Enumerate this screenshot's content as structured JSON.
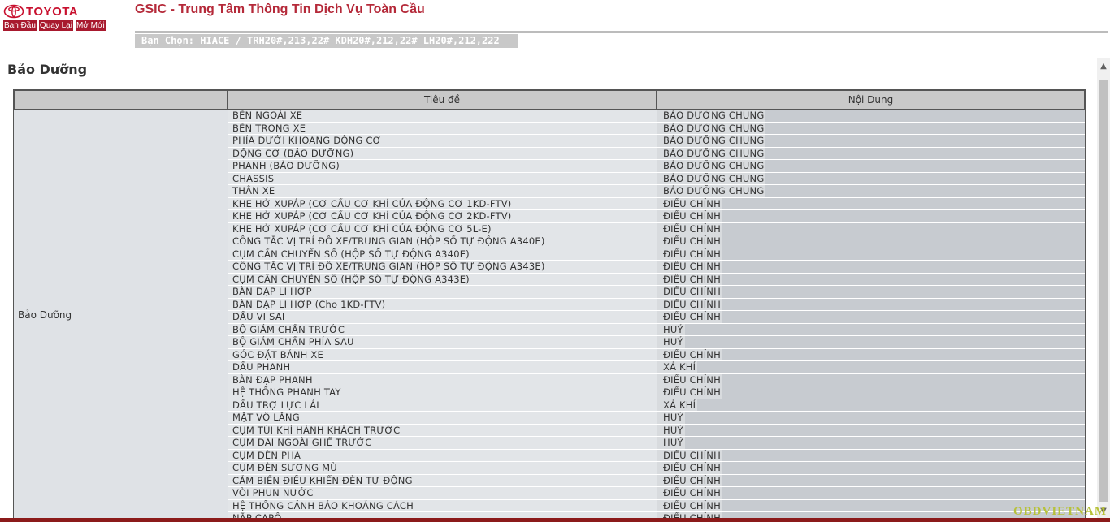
{
  "header": {
    "logo_text": "TOYOTA",
    "app_title": "GSIC - Trung Tâm Thông Tin Dịch Vụ Toàn Cầu",
    "nav": [
      "Ban Đầu",
      "Quay Lại",
      "Mở Mới"
    ],
    "selection": "Bạn Chọn: HIACE / TRH20#,213,22# KDH20#,212,22# LH20#,212,222"
  },
  "section_title": "Bảo Dưỡng",
  "table": {
    "headers": [
      "",
      "Tiêu đề",
      "Nội Dung"
    ],
    "group_label": "Bảo Dưỡng",
    "rows": [
      {
        "title": "BÊN NGOÀI XE",
        "content": "BẢO DƯỠNG CHUNG"
      },
      {
        "title": "BÊN TRONG XE",
        "content": "BẢO DƯỠNG CHUNG"
      },
      {
        "title": "PHÍA DƯỚI KHOANG ĐỘNG CƠ",
        "content": "BẢO DƯỠNG CHUNG"
      },
      {
        "title": "ĐỘNG CƠ (BẢO DƯỠNG)",
        "content": "BẢO DƯỠNG CHUNG"
      },
      {
        "title": "PHANH (BẢO DƯỠNG)",
        "content": "BẢO DƯỠNG CHUNG"
      },
      {
        "title": "CHASSIS",
        "content": "BẢO DƯỠNG CHUNG"
      },
      {
        "title": "THÂN XE",
        "content": "BẢO DƯỠNG CHUNG"
      },
      {
        "title": "KHE HỞ XUPÁP (CƠ CẤU CƠ KHÍ CỦA ĐỘNG CƠ 1KD-FTV)",
        "content": "ĐIỀU CHỈNH"
      },
      {
        "title": "KHE HỞ XUPÁP (CƠ CẤU CƠ KHÍ CỦA ĐỘNG CƠ 2KD-FTV)",
        "content": "ĐIỀU CHỈNH"
      },
      {
        "title": "KHE HỞ XUPÁP (CƠ CẤU CƠ KHÍ CỦA ĐỘNG CƠ 5L-E)",
        "content": "ĐIỀU CHỈNH"
      },
      {
        "title": "CÔNG TẮC VỊ TRÍ ĐỖ XE/TRUNG GIAN (HỘP SỐ TỰ ĐỘNG A340E)",
        "content": "ĐIỀU CHỈNH"
      },
      {
        "title": "CỤM CẦN CHUYỂN SỐ (HỘP SỐ TỰ ĐỘNG A340E)",
        "content": "ĐIỀU CHỈNH"
      },
      {
        "title": "CÔNG TẮC VỊ TRÍ ĐỖ XE/TRUNG GIAN (HỘP SỐ TỰ ĐỘNG A343E)",
        "content": "ĐIỀU CHỈNH"
      },
      {
        "title": "CỤM CẦN CHUYỂN SỐ (HỘP SỐ TỰ ĐỘNG A343E)",
        "content": "ĐIỀU CHỈNH"
      },
      {
        "title": "BÀN ĐẠP LI HỢP",
        "content": "ĐIỀU CHỈNH"
      },
      {
        "title": "BÀN ĐẠP LI HỢP (Cho 1KD-FTV)",
        "content": "ĐIỀU CHỈNH"
      },
      {
        "title": "DẦU VI SAI",
        "content": "ĐIỀU CHỈNH"
      },
      {
        "title": "BỘ GIẢM CHẤN TRƯỚC",
        "content": "HUỶ"
      },
      {
        "title": "BỘ GIẢM CHẤN PHÍA SAU",
        "content": "HUỶ"
      },
      {
        "title": "GÓC ĐẶT BÁNH XE",
        "content": "ĐIỀU CHỈNH"
      },
      {
        "title": "DẦU PHANH",
        "content": "XẢ KHÍ"
      },
      {
        "title": "BÀN ĐẠP PHANH",
        "content": "ĐIỀU CHỈNH"
      },
      {
        "title": "HỆ THỐNG PHANH TAY",
        "content": "ĐIỀU CHỈNH"
      },
      {
        "title": "DẦU TRỢ LỰC LÁI",
        "content": "XẢ KHÍ"
      },
      {
        "title": "MẶT VÔ LĂNG",
        "content": "HUỶ"
      },
      {
        "title": "CỤM TÚI KHÍ HÀNH KHÁCH TRƯỚC",
        "content": "HUỶ"
      },
      {
        "title": "CỤM ĐAI NGOÀI GHẾ TRƯỚC",
        "content": "HUỶ"
      },
      {
        "title": "CỤM ĐÈN PHA",
        "content": "ĐIỀU CHỈNH"
      },
      {
        "title": "CỤM ĐÈN SƯƠNG MÙ",
        "content": "ĐIỀU CHỈNH"
      },
      {
        "title": "CẢM BIẾN ĐIỀU KHIỂN ĐÈN TỰ ĐỘNG",
        "content": "ĐIỀU CHỈNH"
      },
      {
        "title": "VÒI PHUN NƯỚC",
        "content": "ĐIỀU CHỈNH"
      },
      {
        "title": "HỆ THỐNG CẢNH BÁO KHOẢNG CÁCH",
        "content": "ĐIỀU CHỈNH"
      },
      {
        "title": "NẮP CAPÔ",
        "content": "ĐIỀU CHỈNH"
      }
    ]
  },
  "watermark": "OBDVIETNAM",
  "colors": {
    "brand_red": "#c8102e",
    "title_red": "#b52a3a",
    "nav_bg": "#a8192e",
    "header_gray": "#c9c9c9"
  }
}
